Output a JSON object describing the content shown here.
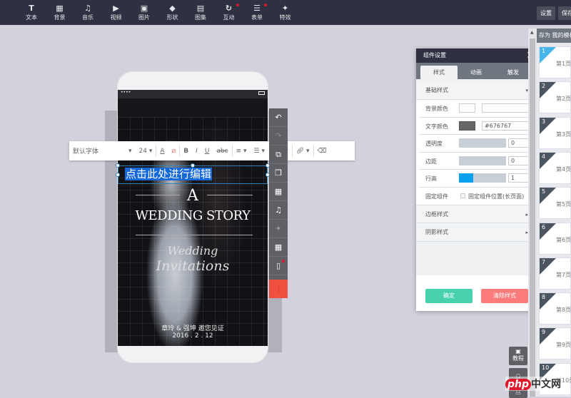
{
  "toolbar": {
    "items": [
      {
        "label": "文本",
        "icon": "T",
        "badge": false
      },
      {
        "label": "背景",
        "icon": "▦",
        "badge": false
      },
      {
        "label": "音乐",
        "icon": "♫",
        "badge": false
      },
      {
        "label": "视频",
        "icon": "▶",
        "badge": false
      },
      {
        "label": "图片",
        "icon": "▣",
        "badge": false
      },
      {
        "label": "形状",
        "icon": "◆",
        "badge": false
      },
      {
        "label": "图集",
        "icon": "▤",
        "badge": false
      },
      {
        "label": "互动",
        "icon": "↻",
        "badge": true
      },
      {
        "label": "表单",
        "icon": "☰",
        "badge": true
      },
      {
        "label": "特效",
        "icon": "✦",
        "badge": false
      }
    ],
    "settings": "设置",
    "save": "保存"
  },
  "phone": {
    "selected_text": "点击此处进行编辑",
    "title_a": "A",
    "title_story": "WEDDING STORY",
    "script1": "Wedding",
    "script2": "Invitations",
    "couple": "章玲 & 强坤 邀您见证",
    "date": "2016 . 2 . 12",
    "dots": "••••"
  },
  "format_bar": {
    "font": "默认字体",
    "size": "24"
  },
  "panel": {
    "title": "组件设置",
    "tabs": [
      "样式",
      "动画",
      "触发"
    ],
    "basic_section": "基础样式",
    "bg_color_label": "背景颜色",
    "bg_color_value": "",
    "text_color_label": "文字颜色",
    "text_color_value": "#676767",
    "text_color": "#676767",
    "opacity_label": "透明度",
    "opacity_value": "0",
    "padding_label": "边距",
    "padding_value": "0",
    "line_height_label": "行高",
    "line_height_value": "1",
    "line_height_fill": 0.3,
    "fixed_label": "固定组件",
    "fixed_option": "固定组件位置(长页面)",
    "border_section": "边框样式",
    "shadow_section": "阴影样式",
    "confirm": "确定",
    "clear": "清除样式"
  },
  "pages": {
    "save_as": "存为 我的模板",
    "items": [
      {
        "n": "1",
        "label": "第1页"
      },
      {
        "n": "2",
        "label": "第2页"
      },
      {
        "n": "3",
        "label": "第3页"
      },
      {
        "n": "4",
        "label": "第4页"
      },
      {
        "n": "5",
        "label": "第5页"
      },
      {
        "n": "6",
        "label": "第6页"
      },
      {
        "n": "7",
        "label": "第7页"
      },
      {
        "n": "8",
        "label": "第8页"
      },
      {
        "n": "9",
        "label": "第9页"
      },
      {
        "n": "10",
        "label": "第10页"
      }
    ]
  },
  "side": {
    "tutorial": "教程"
  },
  "watermark": "php中文网"
}
